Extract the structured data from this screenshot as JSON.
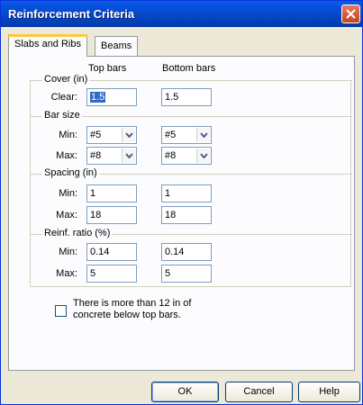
{
  "window": {
    "title": "Reinforcement Criteria"
  },
  "tabs": [
    {
      "label": "Slabs and Ribs"
    },
    {
      "label": "Beams"
    }
  ],
  "columns": {
    "top": "Top bars",
    "bottom": "Bottom bars"
  },
  "cover": {
    "label": "Cover (in)",
    "row_label": "Clear:",
    "top_value": "1.5",
    "bottom_value": "1.5"
  },
  "bar_size": {
    "label": "Bar size",
    "min": {
      "label": "Min:",
      "top": "#5",
      "bottom": "#5"
    },
    "max": {
      "label": "Max:",
      "top": "#8",
      "bottom": "#8"
    }
  },
  "spacing": {
    "label": "Spacing (in)",
    "min": {
      "label": "Min:",
      "top": "1",
      "bottom": "1"
    },
    "max": {
      "label": "Max:",
      "top": "18",
      "bottom": "18"
    }
  },
  "reinf_ratio": {
    "label": "Reinf. ratio (%)",
    "min": {
      "label": "Min:",
      "top": "0.14",
      "bottom": "0.14"
    },
    "max": {
      "label": "Max:",
      "top": "5",
      "bottom": "5"
    }
  },
  "checkbox": {
    "line1": "There is more than 12 in of",
    "line2": "concrete below top bars.",
    "checked": false
  },
  "buttons": {
    "ok": "OK",
    "cancel": "Cancel",
    "help": "Help"
  }
}
